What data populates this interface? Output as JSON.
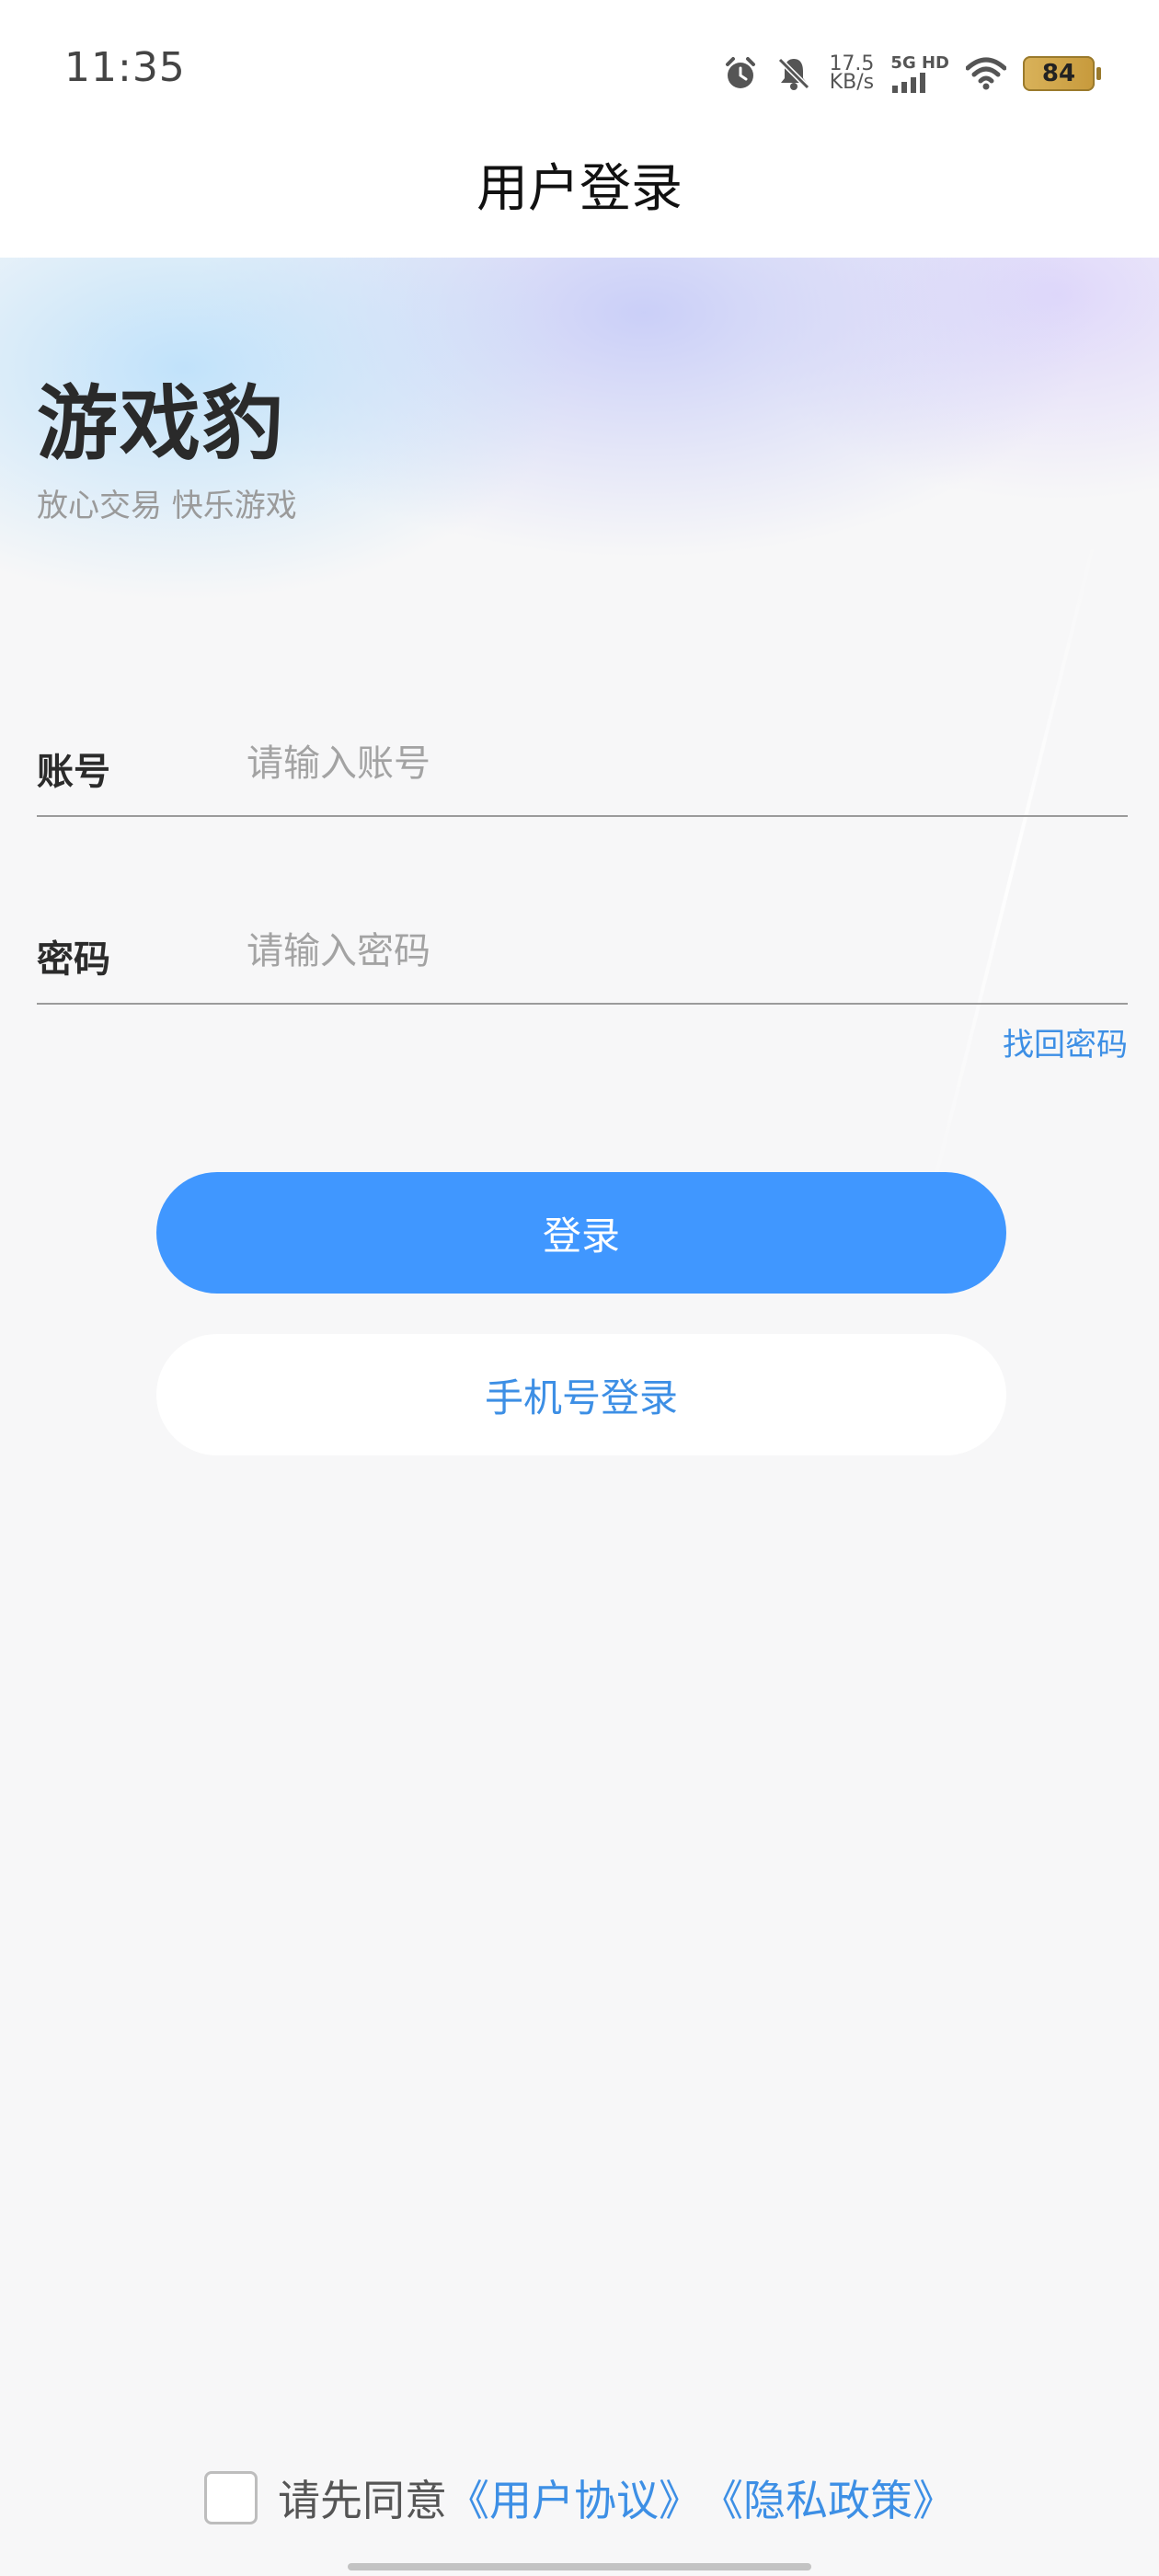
{
  "status_bar": {
    "time": "11:35",
    "net_speed_value": "17.5",
    "net_speed_unit": "KB/s",
    "signal_label": "5G HD",
    "battery_level": "84",
    "icons": [
      "alarm-icon",
      "bell-muted-icon",
      "signal-icon",
      "wifi-icon",
      "battery-icon"
    ]
  },
  "header": {
    "title": "用户登录"
  },
  "brand": {
    "name": "游戏豹",
    "slogan": "放心交易 快乐游戏"
  },
  "form": {
    "account": {
      "label": "账号",
      "placeholder": "请输入账号",
      "value": ""
    },
    "password": {
      "label": "密码",
      "placeholder": "请输入密码",
      "value": ""
    },
    "forgot_label": "找回密码",
    "login_label": "登录",
    "phone_login_label": "手机号登录"
  },
  "agreement": {
    "checked": false,
    "prefix": "请先同意",
    "user_agreement": "《用户协议》",
    "privacy_policy": "《隐私政策》"
  },
  "colors": {
    "accent": "#4097ff",
    "link": "#3d8fe5",
    "background": "#f7f7f8"
  }
}
